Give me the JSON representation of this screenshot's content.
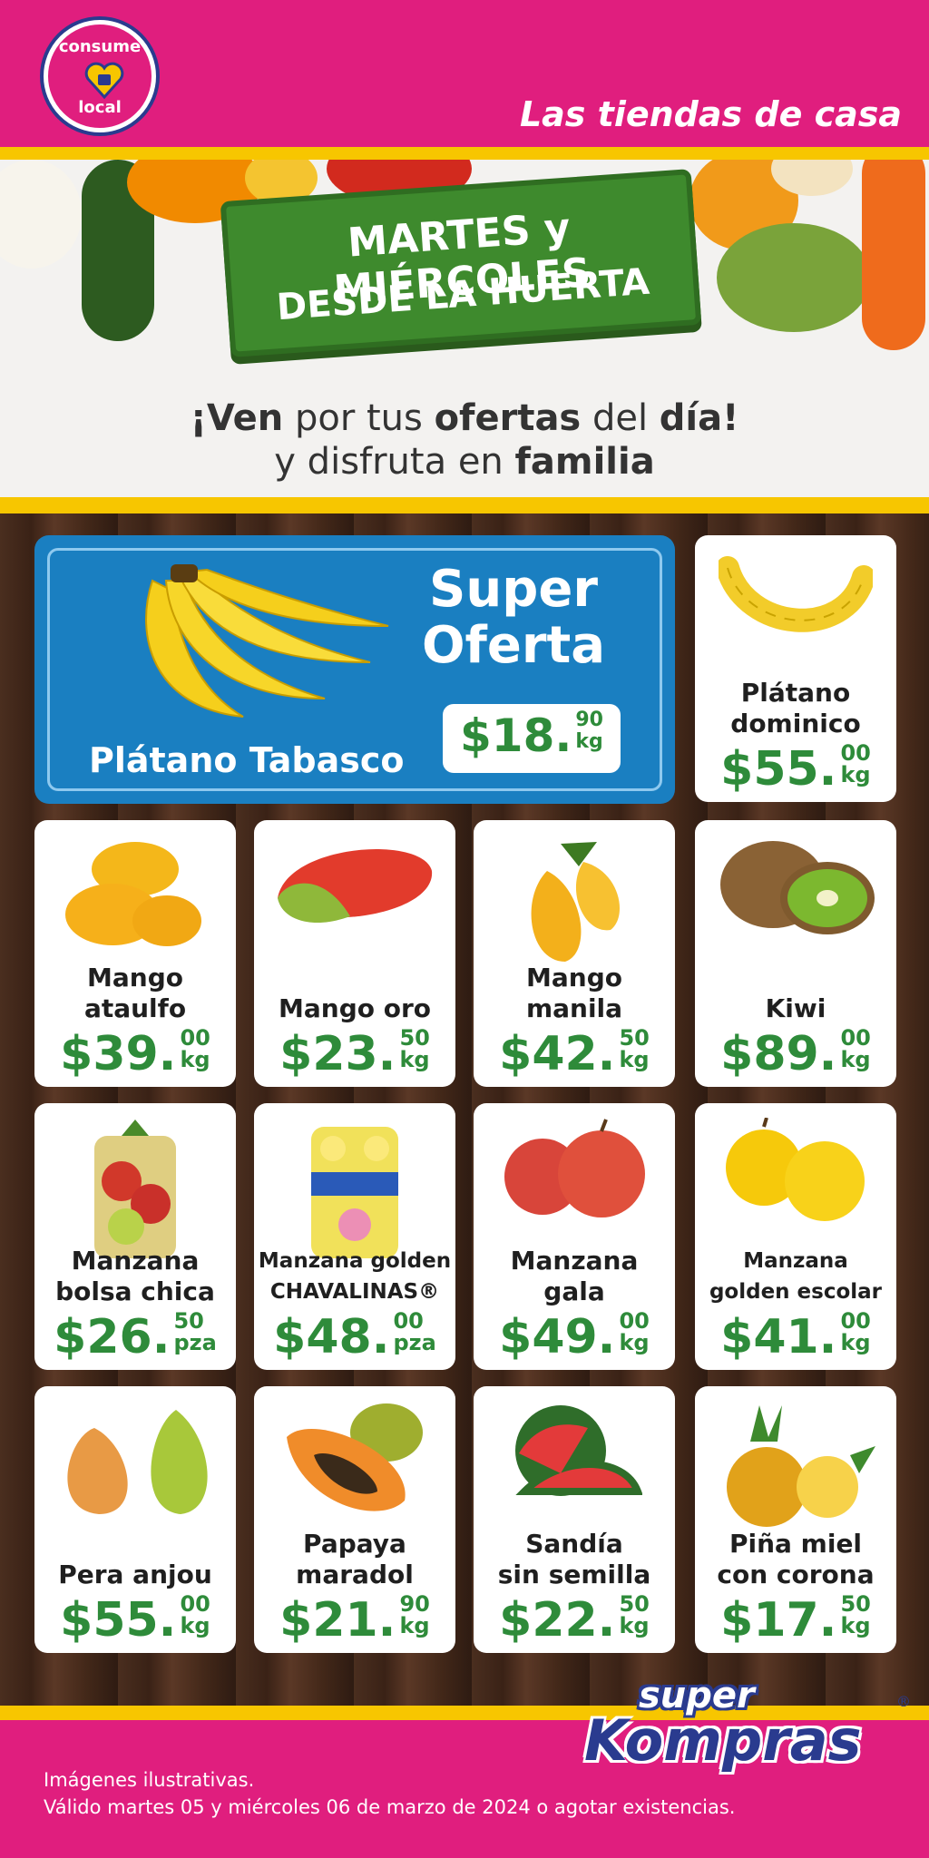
{
  "header": {
    "logo_top": "consume",
    "logo_bottom": "local",
    "tagline": "Las tiendas de casa"
  },
  "hero": {
    "sign_line1": "MARTES y MIÉRCOLES",
    "sign_line2": "DESDE LA HUERTA",
    "line1_parts": [
      "¡Ven",
      " por tus ",
      "ofertas",
      " del ",
      "día!"
    ],
    "line2_parts": [
      "y disfruta en ",
      "familia"
    ]
  },
  "super_oferta": {
    "title_line1": "Super",
    "title_line2": "Oferta",
    "name": "Plátano Tabasco",
    "price_main": "$18.",
    "price_cents": "90",
    "price_unit": "kg"
  },
  "products": [
    {
      "name_l1": "Plátano",
      "name_l2": "dominico",
      "price_main": "$55.",
      "cents": "00",
      "unit": "kg",
      "icon": "bananas-small-icon"
    },
    {
      "name_l1": "Mango",
      "name_l2": "ataulfo",
      "price_main": "$39.",
      "cents": "00",
      "unit": "kg",
      "icon": "mango-ataulfo-icon"
    },
    {
      "name_l1": "",
      "name_l2": "Mango oro",
      "price_main": "$23.",
      "cents": "50",
      "unit": "kg",
      "icon": "mango-oro-icon"
    },
    {
      "name_l1": "Mango",
      "name_l2": "manila",
      "price_main": "$42.",
      "cents": "50",
      "unit": "kg",
      "icon": "mango-manila-icon"
    },
    {
      "name_l1": "",
      "name_l2": "Kiwi",
      "price_main": "$89.",
      "cents": "00",
      "unit": "kg",
      "icon": "kiwi-icon"
    },
    {
      "name_l1": "Manzana",
      "name_l2": "bolsa chica",
      "price_main": "$26.",
      "cents": "50",
      "unit": "pza",
      "icon": "apple-bag-icon"
    },
    {
      "name_l1": "Manzana golden",
      "name_l2": "CHAVALINAS®",
      "price_main": "$48.",
      "cents": "00",
      "unit": "pza",
      "icon": "apple-pack-icon"
    },
    {
      "name_l1": "Manzana",
      "name_l2": "gala",
      "price_main": "$49.",
      "cents": "00",
      "unit": "kg",
      "icon": "apple-gala-icon"
    },
    {
      "name_l1": "Manzana",
      "name_l2": "golden escolar",
      "price_main": "$41.",
      "cents": "00",
      "unit": "kg",
      "icon": "apple-golden-icon"
    },
    {
      "name_l1": "",
      "name_l2": "Pera anjou",
      "price_main": "$55.",
      "cents": "00",
      "unit": "kg",
      "icon": "pear-icon"
    },
    {
      "name_l1": "Papaya",
      "name_l2": "maradol",
      "price_main": "$21.",
      "cents": "90",
      "unit": "kg",
      "icon": "papaya-icon"
    },
    {
      "name_l1": "Sandía",
      "name_l2": "sin semilla",
      "price_main": "$22.",
      "cents": "50",
      "unit": "kg",
      "icon": "watermelon-icon"
    },
    {
      "name_l1": "Piña miel",
      "name_l2": "con corona",
      "price_main": "$17.",
      "cents": "50",
      "unit": "kg",
      "icon": "pineapple-icon"
    }
  ],
  "brand": {
    "line1": "super",
    "line2": "Kompras",
    "reg": "®"
  },
  "legal": {
    "line1": "Imágenes ilustrativas.",
    "line2": "Válido martes 05 y miércoles 06 de marzo de 2024 o agotar existencias."
  },
  "colors": {
    "magenta": "#e01e7e",
    "yellow": "#f7c600",
    "green_price": "#2e8b3a",
    "blue_offer": "#1a7fc1",
    "navy_brand": "#2a3b8f"
  }
}
